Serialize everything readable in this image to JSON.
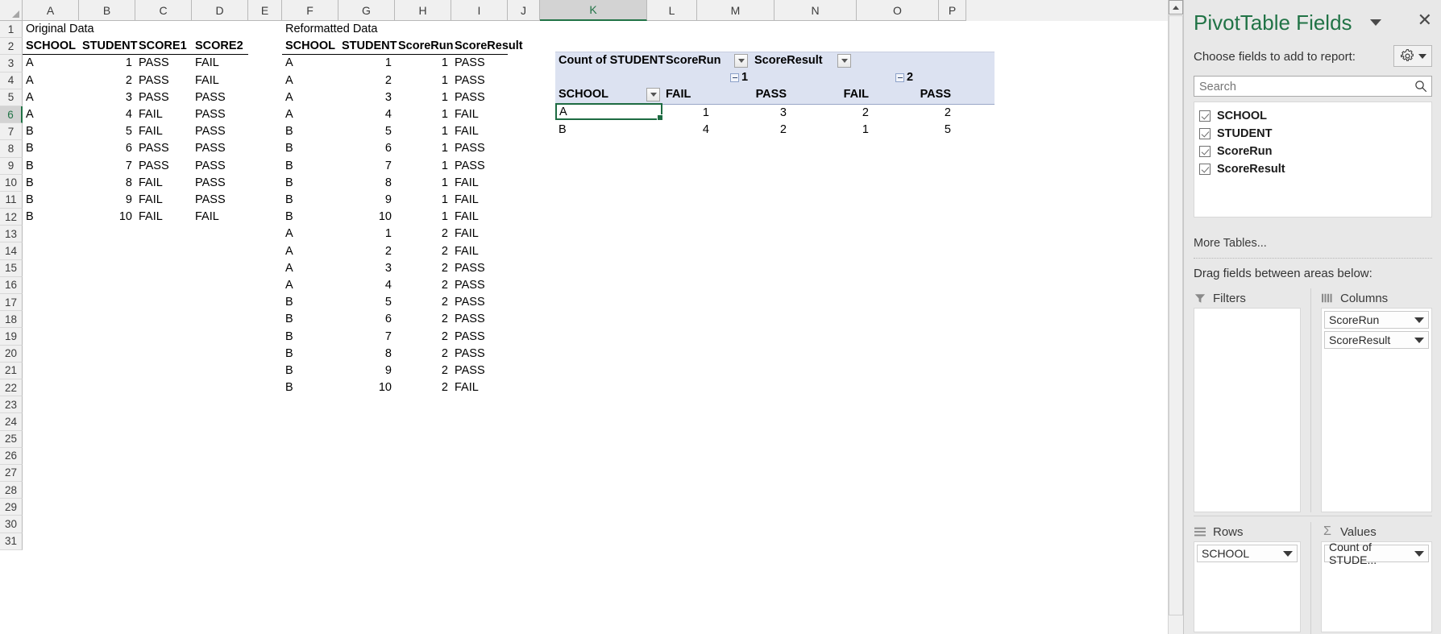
{
  "spreadsheet": {
    "column_headers": [
      "A",
      "B",
      "C",
      "D",
      "E",
      "F",
      "G",
      "H",
      "I",
      "J",
      "K",
      "L",
      "M",
      "N",
      "O",
      "P"
    ],
    "selected_column": "K",
    "selected_row": "6",
    "row_headers": [
      "1",
      "2",
      "3",
      "4",
      "5",
      "6",
      "7",
      "8",
      "9",
      "10",
      "11",
      "12",
      "13",
      "14",
      "15",
      "16",
      "17",
      "18",
      "19",
      "20",
      "21",
      "22",
      "23",
      "24",
      "25",
      "26",
      "27",
      "28",
      "29",
      "30",
      "31"
    ],
    "original_data": {
      "title": "Original Data",
      "headers": [
        "SCHOOL",
        "STUDENT",
        "SCORE1",
        "SCORE2"
      ],
      "rows": [
        [
          "A",
          "1",
          "PASS",
          "FAIL"
        ],
        [
          "A",
          "2",
          "PASS",
          "FAIL"
        ],
        [
          "A",
          "3",
          "PASS",
          "PASS"
        ],
        [
          "A",
          "4",
          "FAIL",
          "PASS"
        ],
        [
          "B",
          "5",
          "FAIL",
          "PASS"
        ],
        [
          "B",
          "6",
          "PASS",
          "PASS"
        ],
        [
          "B",
          "7",
          "PASS",
          "PASS"
        ],
        [
          "B",
          "8",
          "FAIL",
          "PASS"
        ],
        [
          "B",
          "9",
          "FAIL",
          "PASS"
        ],
        [
          "B",
          "10",
          "FAIL",
          "FAIL"
        ]
      ]
    },
    "reformatted_data": {
      "title": "Reformatted Data",
      "headers": [
        "SCHOOL",
        "STUDENT",
        "ScoreRun",
        "ScoreResult"
      ],
      "rows": [
        [
          "A",
          "1",
          "1",
          "PASS"
        ],
        [
          "A",
          "2",
          "1",
          "PASS"
        ],
        [
          "A",
          "3",
          "1",
          "PASS"
        ],
        [
          "A",
          "4",
          "1",
          "FAIL"
        ],
        [
          "B",
          "5",
          "1",
          "FAIL"
        ],
        [
          "B",
          "6",
          "1",
          "PASS"
        ],
        [
          "B",
          "7",
          "1",
          "PASS"
        ],
        [
          "B",
          "8",
          "1",
          "FAIL"
        ],
        [
          "B",
          "9",
          "1",
          "FAIL"
        ],
        [
          "B",
          "10",
          "1",
          "FAIL"
        ],
        [
          "A",
          "1",
          "2",
          "FAIL"
        ],
        [
          "A",
          "2",
          "2",
          "FAIL"
        ],
        [
          "A",
          "3",
          "2",
          "PASS"
        ],
        [
          "A",
          "4",
          "2",
          "PASS"
        ],
        [
          "B",
          "5",
          "2",
          "PASS"
        ],
        [
          "B",
          "6",
          "2",
          "PASS"
        ],
        [
          "B",
          "7",
          "2",
          "PASS"
        ],
        [
          "B",
          "8",
          "2",
          "PASS"
        ],
        [
          "B",
          "9",
          "2",
          "PASS"
        ],
        [
          "B",
          "10",
          "2",
          "FAIL"
        ]
      ]
    },
    "pivot": {
      "value_header": "Count of STUDENT",
      "col_field_1": "ScoreRun",
      "col_field_2": "ScoreResult",
      "row_field": "SCHOOL",
      "group_1": "1",
      "group_2": "2",
      "sub_headers": [
        "FAIL",
        "PASS",
        "FAIL",
        "PASS"
      ],
      "rows": [
        {
          "label": "A",
          "values": [
            "",
            "1",
            "3",
            "2",
            "2"
          ]
        },
        {
          "label": "B",
          "values": [
            "",
            "4",
            "2",
            "1",
            "5"
          ]
        }
      ]
    }
  },
  "fields_panel": {
    "title": "PivotTable Fields",
    "close_label": "✕",
    "choose_label": "Choose fields to add to report:",
    "search": {
      "placeholder": "Search",
      "value": ""
    },
    "fields": [
      {
        "label": "SCHOOL",
        "checked": true
      },
      {
        "label": "STUDENT",
        "checked": true
      },
      {
        "label": "ScoreRun",
        "checked": true
      },
      {
        "label": "ScoreResult",
        "checked": true
      }
    ],
    "more_tables": "More Tables...",
    "drag_label": "Drag fields between areas below:",
    "areas": {
      "filters": {
        "label": "Filters",
        "items": []
      },
      "columns": {
        "label": "Columns",
        "items": [
          "ScoreRun",
          "ScoreResult"
        ]
      },
      "rows": {
        "label": "Rows",
        "items": [
          "SCHOOL"
        ]
      },
      "values": {
        "label": "Values",
        "items": [
          "Count of STUDE..."
        ]
      }
    }
  },
  "colors": {
    "accent": "#217346",
    "pivot_header_bg": "#dce2f1",
    "panel_bg": "#e8e8e8",
    "selection_border": "#1d6b42"
  }
}
